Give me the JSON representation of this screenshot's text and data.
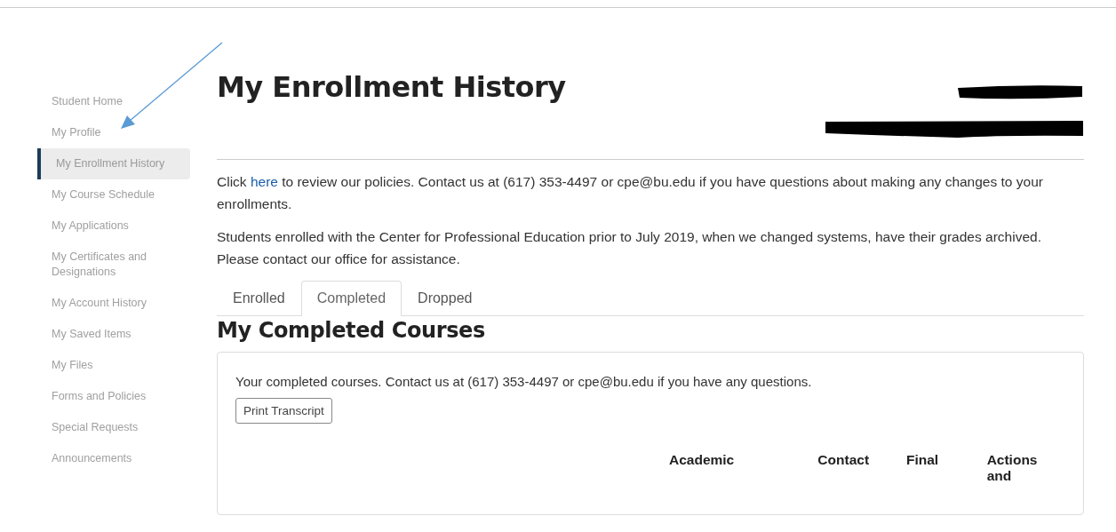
{
  "sidebar": {
    "items": [
      {
        "label": "Student Home",
        "selected": false
      },
      {
        "label": "My Profile",
        "selected": false
      },
      {
        "label": "My Enrollment History",
        "selected": true
      },
      {
        "label": "My Course Schedule",
        "selected": false
      },
      {
        "label": "My Applications",
        "selected": false
      },
      {
        "label": "My Certificates and Designations",
        "selected": false
      },
      {
        "label": "My Account History",
        "selected": false
      },
      {
        "label": "My Saved Items",
        "selected": false
      },
      {
        "label": "My Files",
        "selected": false
      },
      {
        "label": "Forms and Policies",
        "selected": false
      },
      {
        "label": "Special Requests",
        "selected": false
      },
      {
        "label": "Announcements",
        "selected": false
      }
    ]
  },
  "page_title": "My Enrollment History",
  "notice": {
    "before": "Click ",
    "link": "here",
    "after": " to review our policies. Contact us at (617) 353-4497 or cpe@bu.edu if you have questions about making any changes to your enrollments."
  },
  "archive_note": "Students enrolled with the Center for Professional Education prior to July 2019, when we changed systems, have their grades archived.  Please contact our office for assistance.",
  "tabs": [
    {
      "label": "Enrolled",
      "selected": false
    },
    {
      "label": "Completed",
      "selected": true
    },
    {
      "label": "Dropped",
      "selected": false
    }
  ],
  "section_title": "My Completed Courses",
  "card": {
    "intro": "Your completed courses. Contact us at (617) 353-4497 or cpe@bu.edu if you have any questions.",
    "button": "Print Transcript",
    "columns": [
      "Academic",
      "Contact",
      "Final",
      "Actions and"
    ]
  }
}
